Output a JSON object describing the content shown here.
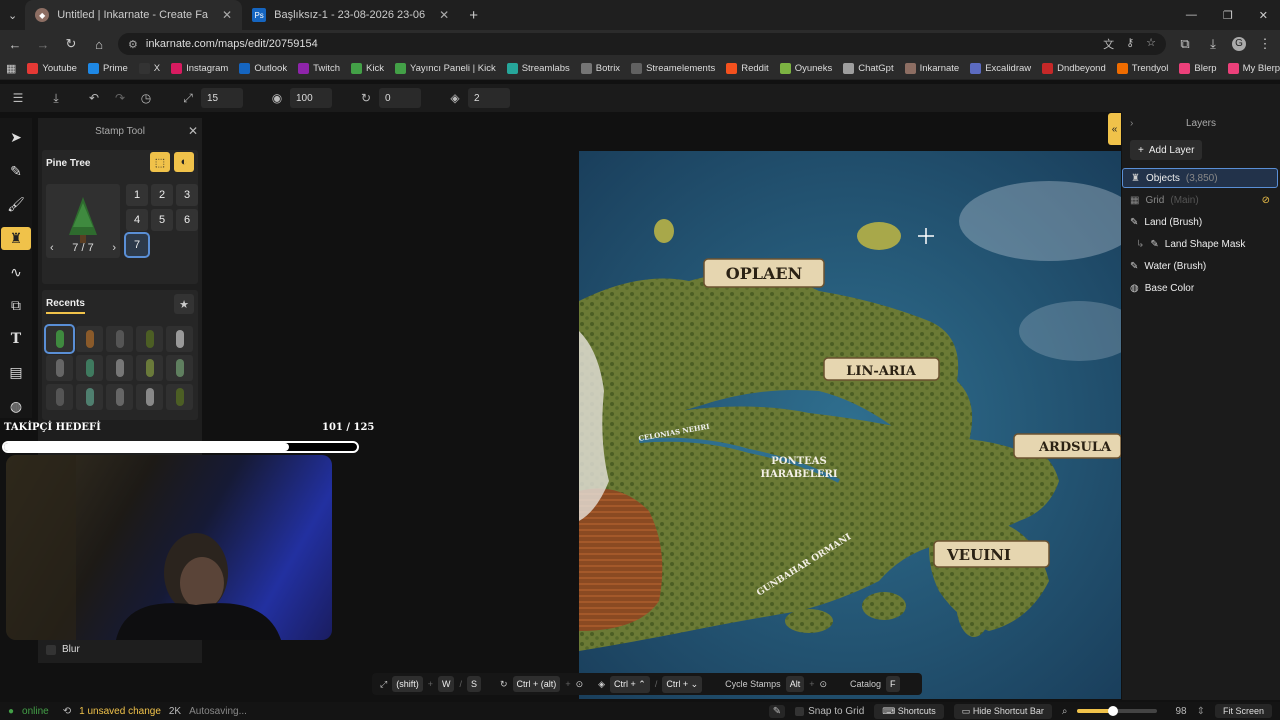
{
  "browser": {
    "tabs": [
      {
        "title": "Untitled | Inkarnate - Create Fa",
        "active": true
      },
      {
        "title": "Başlıksız-1 - 23-08-2026 23-06",
        "active": false
      }
    ],
    "url": "inkarnate.com/maps/edit/20759154",
    "window_controls": [
      "—",
      "❐",
      "✕"
    ],
    "bookmarks": [
      {
        "label": "Youtube",
        "color": "#e53935"
      },
      {
        "label": "Prime",
        "color": "#1e88e5"
      },
      {
        "label": "X",
        "color": "#333333"
      },
      {
        "label": "Instagram",
        "color": "#d81b60"
      },
      {
        "label": "Outlook",
        "color": "#1565c0"
      },
      {
        "label": "Twitch",
        "color": "#8e24aa"
      },
      {
        "label": "Kick",
        "color": "#43a047"
      },
      {
        "label": "Yayıncı Paneli | Kick",
        "color": "#43a047"
      },
      {
        "label": "Streamlabs",
        "color": "#26a69a"
      },
      {
        "label": "Botrix",
        "color": "#757575"
      },
      {
        "label": "Streamelements",
        "color": "#616161"
      },
      {
        "label": "Reddit",
        "color": "#f4511e"
      },
      {
        "label": "Oyuneks",
        "color": "#7cb342"
      },
      {
        "label": "ChatGpt",
        "color": "#9e9e9e"
      },
      {
        "label": "Inkarnate",
        "color": "#8d6e63"
      },
      {
        "label": "Excalidraw",
        "color": "#5c6bc0"
      },
      {
        "label": "Dndbeyond",
        "color": "#c62828"
      },
      {
        "label": "Trendyol",
        "color": "#ef6c00"
      },
      {
        "label": "Blerp",
        "color": "#ec407a"
      },
      {
        "label": "My Blerps Dashboard",
        "color": "#ec407a"
      }
    ]
  },
  "toolbar": {
    "size": "15",
    "opacity": "100",
    "rotation": "0",
    "layer": "2"
  },
  "stamp_tool": {
    "title": "Stamp Tool",
    "stamp_name": "Pine Tree",
    "variant_counter": "7 / 7",
    "variants": [
      "1",
      "2",
      "3",
      "4",
      "5",
      "6",
      "7"
    ],
    "selected_variant": 7,
    "recents_label": "Recents",
    "blur_label": "Blur"
  },
  "overlay": {
    "follower_label": "TAKİPÇİ HEDEFİ",
    "follower_count": "101 / 125",
    "follower_progress": 0.808
  },
  "map": {
    "labels": [
      "OPLAEN",
      "LIN-ARIA",
      "ARDSULA",
      "VEUINI",
      "CELONIAS NEHRI",
      "PONTEAS",
      "HARABELERI",
      "GUNBAHAR ORMANI"
    ]
  },
  "layers": {
    "title": "Layers",
    "add_label": "Add Layer",
    "items": [
      {
        "name": "Objects",
        "count": "(3,850)",
        "selected": true
      },
      {
        "name": "Grid",
        "count": "(Main)",
        "disabled": true
      },
      {
        "name": "Land (Brush)"
      },
      {
        "name": "Land Shape Mask"
      },
      {
        "name": "Water (Brush)"
      },
      {
        "name": "Base Color"
      }
    ]
  },
  "shortcuts": {
    "shift": "(shift)",
    "w": "W",
    "s": "S",
    "ctrl_alt": "Ctrl + (alt)",
    "ctrl_up": "Ctrl + ⌃",
    "ctrl_down": "Ctrl + ⌄",
    "cycle_label": "Cycle Stamps",
    "alt": "Alt",
    "catalog_label": "Catalog",
    "f": "F"
  },
  "status": {
    "online": "online",
    "unsaved": "1 unsaved change",
    "resolution": "2K",
    "autosave": "Autosaving...",
    "snap": "Snap to Grid",
    "shortcuts_btn": "Shortcuts",
    "hide_bar": "Hide Shortcut Bar",
    "zoom": "98",
    "zoom_level": 0.45,
    "fit": "Fit Screen"
  },
  "colors": {
    "accent": "#f0c24a",
    "selection": "#5a8fd6",
    "online": "#43a047",
    "unsaved": "#f0c24a"
  }
}
